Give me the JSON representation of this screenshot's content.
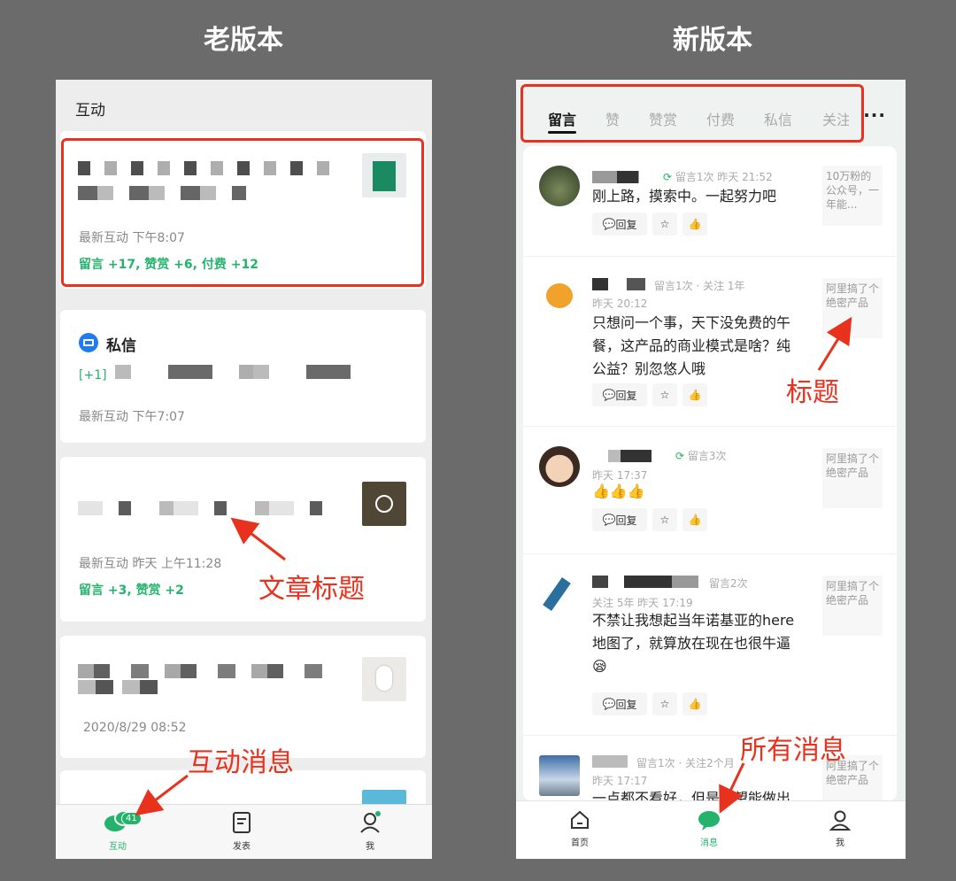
{
  "headings": {
    "old": "老版本",
    "new": "新版本"
  },
  "old_app": {
    "title": "互动",
    "cards": [
      {
        "latest": "最新互动 下午8:07",
        "stats": [
          "留言 +17",
          "赞赏 +6",
          "付费 +12"
        ]
      },
      {
        "icon_label": "私信",
        "prefix": "[+1]",
        "latest": "最新互动  下午7:07"
      },
      {
        "latest": "最新互动 昨天 上午11:28",
        "stats": [
          "留言 +3",
          "赞赏 +2"
        ]
      },
      {
        "latest": "2020/8/29  08:52"
      }
    ],
    "tabbar": [
      {
        "label": "互动",
        "badge": "41"
      },
      {
        "label": "发表"
      },
      {
        "label": "我"
      }
    ]
  },
  "new_app": {
    "tabs": [
      "留言",
      "赞",
      "赞赏",
      "付费",
      "私信",
      "关注"
    ],
    "more_label": "···",
    "items": [
      {
        "badge": "留言1次   昨天 21:52",
        "comment": "刚上路，摸索中。一起努力吧",
        "side": "10万粉的公众号，一年能..."
      },
      {
        "badge": "留言1次 · 关注 1年",
        "time": "昨天 20:12",
        "comment": "只想问一个事，天下没免费的午餐，这产品的商业模式是啥？纯公益？别忽悠人哦",
        "side": "阿里搞了个绝密产品"
      },
      {
        "badge": "留言3次",
        "time": "昨天 17:37",
        "comment": "👍👍👍",
        "side": "阿里搞了个绝密产品"
      },
      {
        "badge": "留言2次",
        "time": "关注 5年   昨天 17:19",
        "comment": "不禁让我想起当年诺基亚的here地图了，就算放在现在也很牛逼😪",
        "side": "阿里搞了个绝密产品"
      },
      {
        "badge": "留言1次 · 关注2个月",
        "time": "昨天 17:17",
        "comment": "一点都不看好，但是希望能做出",
        "side": "阿里搞了个绝密产品"
      }
    ],
    "reply_label": "回复",
    "tabbar": [
      {
        "label": "首页"
      },
      {
        "label": "消息"
      },
      {
        "label": "我"
      }
    ]
  },
  "annotations": {
    "article_title": "文章标题",
    "interaction_msgs": "互动消息",
    "title": "标题",
    "all_msgs": "所有消息"
  },
  "colors": {
    "accent": "#23b36b",
    "annotation": "#e8321e",
    "background": "#6b6b6b"
  }
}
